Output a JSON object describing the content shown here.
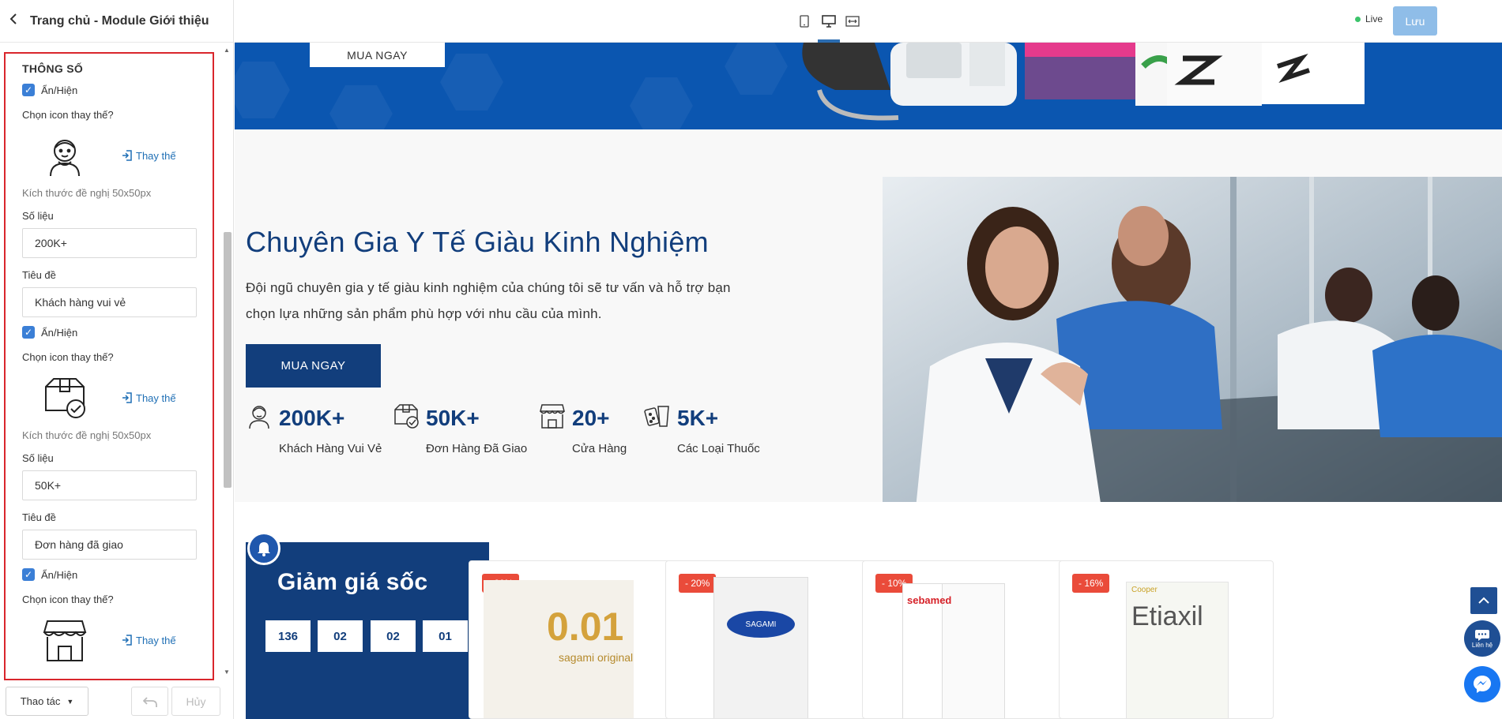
{
  "left_panel": {
    "header_title": "Trang chủ - Module Giới thiệu",
    "section_title": "THÔNG SỐ",
    "items": [
      {
        "toggle_label": "Ẩn/Hiện",
        "icon_label": "Chọn icon thay thế?",
        "replace_label": "Thay thế",
        "size_hint": "Kích thước đề nghị 50x50px",
        "value_label": "Số liệu",
        "value": "200K+",
        "title_label": "Tiêu đề",
        "title": "Khách hàng vui vẻ"
      },
      {
        "toggle_label": "Ẩn/Hiện",
        "icon_label": "Chọn icon thay thế?",
        "replace_label": "Thay thế",
        "size_hint": "Kích thước đề nghị 50x50px",
        "value_label": "Số liệu",
        "value": "50K+",
        "title_label": "Tiêu đề",
        "title": "Đơn hàng đã giao"
      },
      {
        "toggle_label": "Ẩn/Hiện",
        "icon_label": "Chọn icon thay thế?",
        "replace_label": "Thay thế"
      }
    ],
    "footer": {
      "action_label": "Thao tác",
      "redo_label": "Hủy"
    }
  },
  "topbar": {
    "live_label": "Live",
    "save_label": "Lưu"
  },
  "canvas": {
    "banner_button": "MUA NGAY",
    "intro": {
      "title": "Chuyên Gia Y Tế Giàu Kinh Nghiệm",
      "text": "Đội ngũ chuyên gia y tế giàu kinh nghiệm của chúng tôi sẽ tư vấn và hỗ trợ bạn chọn lựa những sản phẩm phù hợp với nhu cầu của mình.",
      "button": "MUA NGAY",
      "stats": [
        {
          "value": "200K+",
          "caption": "Khách Hàng Vui Vẻ"
        },
        {
          "value": "50K+",
          "caption": "Đơn Hàng Đã Giao"
        },
        {
          "value": "20+",
          "caption": "Cửa Hàng"
        },
        {
          "value": "5K+",
          "caption": "Các Loại Thuốc"
        }
      ]
    },
    "deals": {
      "title": "Giảm giá sốc",
      "countdown": [
        "136",
        "02",
        "02",
        "01"
      ],
      "products": [
        {
          "badge": "- 20%",
          "brand_text": "0.01",
          "sub_text": "sagami original"
        },
        {
          "badge": "- 20%",
          "brand_text": "SAGAMI"
        },
        {
          "badge": "- 10%",
          "brand_text": "sebamed"
        },
        {
          "badge": "- 16%",
          "brand_text": "Etiaxil",
          "sub_text": "Cooper"
        }
      ]
    },
    "contact_label": "Liên hệ"
  },
  "colors": {
    "accent": "#123e7c",
    "banner": "#0b56b0",
    "badge": "#ea4b3a",
    "highlight_border": "#d9262c",
    "checkbox": "#3b7fd6"
  }
}
